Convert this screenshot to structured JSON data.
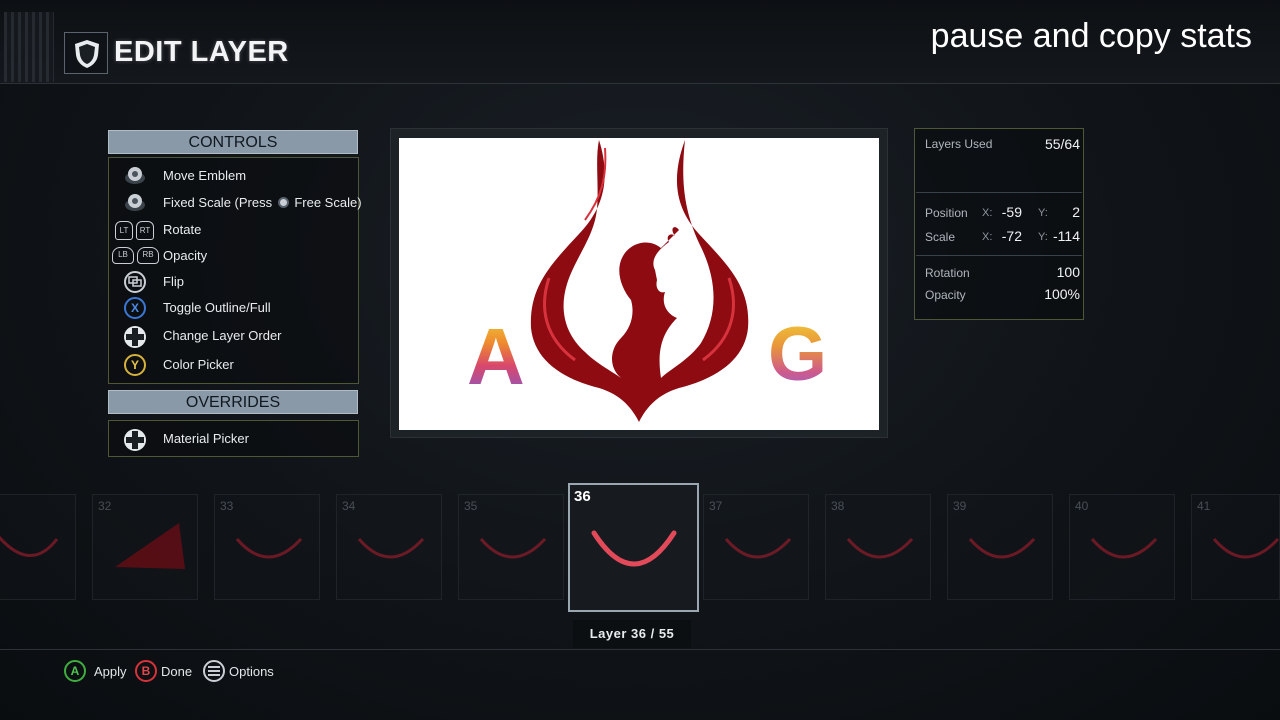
{
  "header": {
    "title": "EDIT LAYER",
    "overlay_caption": "pause and copy stats"
  },
  "controls": {
    "heading": "CONTROLS",
    "items": [
      {
        "icon": "left-stick-icon",
        "label": "Move Emblem"
      },
      {
        "icon": "right-stick-icon",
        "label": "Fixed Scale (Press",
        "label_suffix": "Free Scale)"
      },
      {
        "icon": "lt-rt-triggers-icon",
        "label": "Rotate"
      },
      {
        "icon": "lb-rb-bumpers-icon",
        "label": "Opacity"
      },
      {
        "icon": "view-button-icon",
        "label": "Flip"
      },
      {
        "icon": "x-button-icon",
        "label": "Toggle Outline/Full"
      },
      {
        "icon": "dpad-icon",
        "label": "Change Layer Order"
      },
      {
        "icon": "y-button-icon",
        "label": "Color Picker"
      }
    ]
  },
  "overrides": {
    "heading": "OVERRIDES",
    "items": [
      {
        "icon": "dpad-icon",
        "label": "Material Picker"
      }
    ]
  },
  "emblem": {
    "letter_left": "A",
    "letter_right": "G",
    "phoenix_color": "#8f0b12",
    "background": "#ffffff"
  },
  "stats": {
    "layers_used_label": "Layers Used",
    "layers_used_value": "55/64",
    "position_label": "Position",
    "position_x": "-59",
    "position_y": "2",
    "scale_label": "Scale",
    "scale_x": "-72",
    "scale_y": "-114",
    "axis_x": "X:",
    "axis_y": "Y:",
    "rotation_label": "Rotation",
    "rotation_value": "100",
    "opacity_label": "Opacity",
    "opacity_value": "100%"
  },
  "layers": {
    "tiles": [
      {
        "number": ""
      },
      {
        "number": "32"
      },
      {
        "number": "33"
      },
      {
        "number": "34"
      },
      {
        "number": "35"
      },
      {
        "number": "36",
        "active": true
      },
      {
        "number": "37"
      },
      {
        "number": "38"
      },
      {
        "number": "39"
      },
      {
        "number": "40"
      },
      {
        "number": "41"
      }
    ],
    "caption": "Layer 36 / 55"
  },
  "footer": {
    "apply": {
      "button": "A",
      "label": "Apply",
      "color": "#3fae3f"
    },
    "done": {
      "button": "B",
      "label": "Done",
      "color": "#d8323a"
    },
    "options": {
      "label": "Options"
    }
  }
}
